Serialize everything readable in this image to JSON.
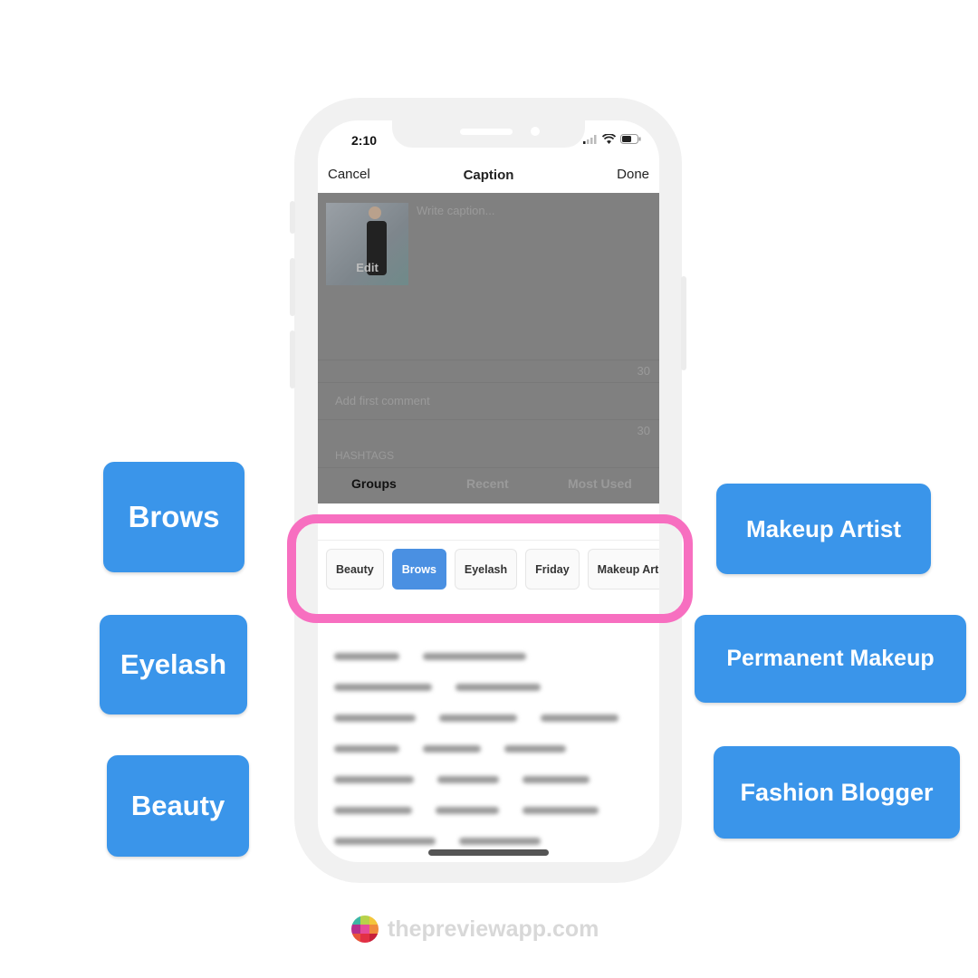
{
  "status_bar": {
    "time": "2:10"
  },
  "nav": {
    "cancel": "Cancel",
    "title": "Caption",
    "done": "Done"
  },
  "caption": {
    "placeholder": "Write caption...",
    "thumbnail_label": "Edit",
    "count": "30"
  },
  "comment": {
    "placeholder": "Add first comment",
    "count": "30"
  },
  "hashtags": {
    "heading": "HASHTAGS",
    "tabs": [
      {
        "label": "Groups",
        "active": true
      },
      {
        "label": "Recent"
      },
      {
        "label": "Most Used"
      }
    ]
  },
  "groups": [
    {
      "label": "Beauty"
    },
    {
      "label": "Brows",
      "active": true
    },
    {
      "label": "Eyelash"
    },
    {
      "label": "Friday"
    },
    {
      "label": "Makeup Arti"
    }
  ],
  "callouts": {
    "brows": "Brows",
    "eyelash": "Eyelash",
    "beauty": "Beauty",
    "makeup_artist": "Makeup Artist",
    "permanent_makeup": "Permanent Makeup",
    "fashion_blogger": "Fashion Blogger"
  },
  "brand": {
    "text": "thepreviewapp.com"
  },
  "colors": {
    "accent": "#4a90e2",
    "callout": "#3a95ea",
    "highlight": "#f76fc0"
  }
}
